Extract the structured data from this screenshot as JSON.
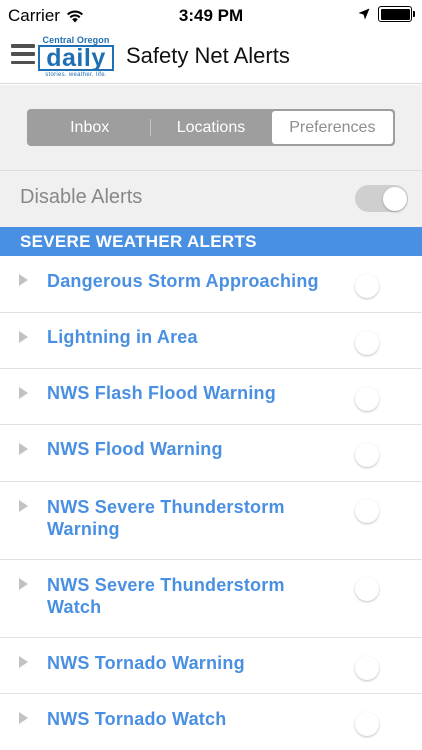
{
  "status_bar": {
    "carrier": "Carrier",
    "time": "3:49 PM",
    "battery_level": 1.0
  },
  "nav": {
    "logo": {
      "top": "Central Oregon",
      "main": "daily",
      "tagline": "stories. weather. life."
    },
    "title": "Safety Net Alerts"
  },
  "tabs": [
    {
      "label": "Inbox",
      "active": false
    },
    {
      "label": "Locations",
      "active": false
    },
    {
      "label": "Preferences",
      "active": true
    }
  ],
  "disable_alerts": {
    "label": "Disable Alerts",
    "enabled": false
  },
  "section": {
    "title": "SEVERE WEATHER ALERTS"
  },
  "alerts": [
    {
      "label": "Dangerous Storm Approaching",
      "enabled": true
    },
    {
      "label": "Lightning in Area",
      "enabled": true
    },
    {
      "label": "NWS Flash Flood Warning",
      "enabled": true
    },
    {
      "label": "NWS Flood Warning",
      "enabled": true
    },
    {
      "label": "NWS Severe Thunderstorm Warning",
      "enabled": true
    },
    {
      "label": "NWS Severe Thunderstorm Watch",
      "enabled": true
    },
    {
      "label": "NWS Tornado Warning",
      "enabled": true
    },
    {
      "label": "NWS Tornado Watch",
      "enabled": true
    }
  ],
  "colors": {
    "accent": "#4a90e2",
    "segment_bg": "#9e9e9e",
    "panel_bg": "#f0f0f0"
  }
}
